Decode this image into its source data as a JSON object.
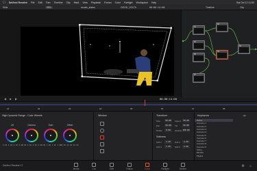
{
  "menubar": {
    "app": "DaVinci Resolve",
    "items": [
      "File",
      "Edit",
      "Trim",
      "Timeline",
      "Clip",
      "Mark",
      "View",
      "Playback",
      "Fusion",
      "Color",
      "Fairlight",
      "Workspace",
      "Help"
    ],
    "clock": "Sat Oct 12 11:52"
  },
  "toolbar": {
    "left_label": "Stills",
    "zoom": "99%",
    "clip_name": "reoder_states",
    "timeline_name": "GOOD_VOLTA",
    "timecode_top": "00:00:14:00",
    "right_label": "Timeline",
    "clip_label": "Clip"
  },
  "viewer": {
    "timecode": "00:00:14:00"
  },
  "timeline": {
    "clips": [
      "01",
      "02",
      "03",
      "04",
      "05",
      "06",
      "07",
      "08"
    ]
  },
  "nodes": {
    "items": [
      {
        "label": "01"
      },
      {
        "label": "02"
      },
      {
        "label": "03"
      },
      {
        "label": "04"
      },
      {
        "label": "05"
      },
      {
        "label": "06"
      },
      {
        "label": "07"
      }
    ]
  },
  "color": {
    "panel_title": "High Dynamic Range - Color Wheels",
    "wheels": [
      {
        "label": "Lift",
        "values": "0.00 0.00 0.00 0.00"
      },
      {
        "label": "Gamma",
        "values": "0.00 0.00 0.00 0.00"
      },
      {
        "label": "Gain",
        "values": "1.00 1.00 1.00 1.00"
      },
      {
        "label": "Offset",
        "values": "25.00 25.00 25.00"
      }
    ],
    "window_title": "Window",
    "transform_title": "Transform",
    "transform_fields": [
      {
        "label": "Size",
        "val": "50.00"
      },
      {
        "label": "Aspect",
        "val": "50.00"
      },
      {
        "label": "Pan",
        "val": "50.00"
      },
      {
        "label": "Tilt",
        "val": "50.00"
      },
      {
        "label": "Rotate",
        "val": "0.00"
      },
      {
        "label": "Opacity",
        "val": "100.00"
      }
    ],
    "softness_title": "Softness",
    "softness_fields": [
      {
        "label": "Soft 1",
        "val": "1.25"
      },
      {
        "label": "Soft 2",
        "val": "1.25"
      },
      {
        "label": "Soft 3",
        "val": "1.25"
      },
      {
        "label": "Soft 4",
        "val": "1.25"
      }
    ],
    "keyframes_title": "Keyframes",
    "keyframes_mode": "All",
    "keyframe_rows": [
      "Master",
      "Corrector 1",
      "Corrector 2",
      "Corrector 3",
      "Corrector 4",
      "Corrector 5",
      "Corrector 6",
      "Corrector 7",
      "Corrector 8",
      "Corrector 9",
      "Sizing",
      "Window",
      "Plugins"
    ]
  },
  "bottombar": {
    "app_label": "DaVinci Resolve 17",
    "pages": [
      "Media",
      "Cut",
      "Edit",
      "Fusion",
      "Color",
      "Fairlight",
      "Deliver"
    ],
    "active_page": "Color"
  }
}
